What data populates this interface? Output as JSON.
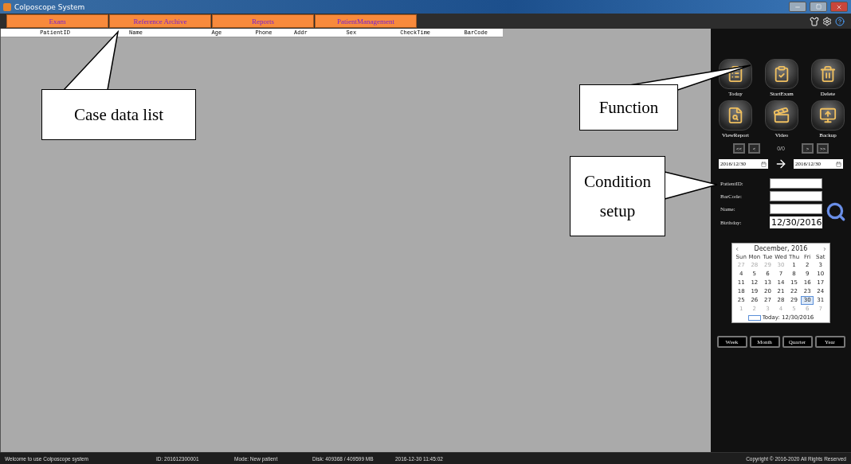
{
  "window": {
    "title": "Colposcope System"
  },
  "tabs": [
    {
      "label": "Exam",
      "selected": false
    },
    {
      "label": "Reference Archive",
      "selected": false
    },
    {
      "label": "Reports",
      "selected": false
    },
    {
      "label": "PatientManagement",
      "selected": false
    }
  ],
  "table": {
    "columns": [
      "PatientID",
      "Name",
      "Age",
      "Phone",
      "Addr",
      "Sex",
      "CheckTime",
      "BarCode"
    ]
  },
  "functions": [
    {
      "label": "Today",
      "kind": "today"
    },
    {
      "label": "StartExam",
      "kind": "start"
    },
    {
      "label": "Delete",
      "kind": "delete"
    },
    {
      "label": "ViewReport",
      "kind": "report"
    },
    {
      "label": "Video",
      "kind": "video"
    },
    {
      "label": "Backup",
      "kind": "backup"
    }
  ],
  "pager": {
    "first": "<<",
    "prev": "<",
    "count": "0/0",
    "next": ">",
    "last": ">>"
  },
  "date_range": {
    "from": "2016/12/30",
    "to": "2016/12/30"
  },
  "conditions": [
    {
      "label": "PatientID:",
      "kind": "text"
    },
    {
      "label": "BarCode:",
      "kind": "text"
    },
    {
      "label": "Name:",
      "kind": "text"
    },
    {
      "label": "Birthday:",
      "kind": "date",
      "value": "12/30/2016"
    }
  ],
  "calendar": {
    "title": "December, 2016",
    "weekdays": [
      "Sun",
      "Mon",
      "Tue",
      "Wed",
      "Thu",
      "Fri",
      "Sat"
    ],
    "weeks": [
      [
        {
          "day": "27",
          "other_month": true,
          "selected": false
        },
        {
          "day": "28",
          "other_month": true,
          "selected": false
        },
        {
          "day": "29",
          "other_month": true,
          "selected": false
        },
        {
          "day": "30",
          "other_month": true,
          "selected": false
        },
        {
          "day": "1",
          "other_month": false,
          "selected": false
        },
        {
          "day": "2",
          "other_month": false,
          "selected": false
        },
        {
          "day": "3",
          "other_month": false,
          "selected": false
        }
      ],
      [
        {
          "day": "4",
          "other_month": false,
          "selected": false
        },
        {
          "day": "5",
          "other_month": false,
          "selected": false
        },
        {
          "day": "6",
          "other_month": false,
          "selected": false
        },
        {
          "day": "7",
          "other_month": false,
          "selected": false
        },
        {
          "day": "8",
          "other_month": false,
          "selected": false
        },
        {
          "day": "9",
          "other_month": false,
          "selected": false
        },
        {
          "day": "10",
          "other_month": false,
          "selected": false
        }
      ],
      [
        {
          "day": "11",
          "other_month": false,
          "selected": false
        },
        {
          "day": "12",
          "other_month": false,
          "selected": false
        },
        {
          "day": "13",
          "other_month": false,
          "selected": false
        },
        {
          "day": "14",
          "other_month": false,
          "selected": false
        },
        {
          "day": "15",
          "other_month": false,
          "selected": false
        },
        {
          "day": "16",
          "other_month": false,
          "selected": false
        },
        {
          "day": "17",
          "other_month": false,
          "selected": false
        }
      ],
      [
        {
          "day": "18",
          "other_month": false,
          "selected": false
        },
        {
          "day": "19",
          "other_month": false,
          "selected": false
        },
        {
          "day": "20",
          "other_month": false,
          "selected": false
        },
        {
          "day": "21",
          "other_month": false,
          "selected": false
        },
        {
          "day": "22",
          "other_month": false,
          "selected": false
        },
        {
          "day": "23",
          "other_month": false,
          "selected": false
        },
        {
          "day": "24",
          "other_month": false,
          "selected": false
        }
      ],
      [
        {
          "day": "25",
          "other_month": false,
          "selected": false
        },
        {
          "day": "26",
          "other_month": false,
          "selected": false
        },
        {
          "day": "27",
          "other_month": false,
          "selected": false
        },
        {
          "day": "28",
          "other_month": false,
          "selected": false
        },
        {
          "day": "29",
          "other_month": false,
          "selected": false
        },
        {
          "day": "30",
          "other_month": false,
          "selected": true
        },
        {
          "day": "31",
          "other_month": false,
          "selected": false
        }
      ],
      [
        {
          "day": "1",
          "other_month": true,
          "selected": false
        },
        {
          "day": "2",
          "other_month": true,
          "selected": false
        },
        {
          "day": "3",
          "other_month": true,
          "selected": false
        },
        {
          "day": "4",
          "other_month": true,
          "selected": false
        },
        {
          "day": "5",
          "other_month": true,
          "selected": false
        },
        {
          "day": "6",
          "other_month": true,
          "selected": false
        },
        {
          "day": "7",
          "other_month": true,
          "selected": false
        }
      ]
    ],
    "today": "Today: 12/30/2016"
  },
  "periods": [
    "Week",
    "Month",
    "Quarter",
    "Year"
  ],
  "status_bar": {
    "welcome": "Welcome to use  Colposcope system",
    "id": "ID: 201612300001",
    "mode": "Mode:  New patient",
    "disk": "Disk:   409368 / 409599 MB",
    "time": "2016-12-30  11:45:02",
    "copyright": "Copyright © 2016-2020 All Rights Reserved"
  },
  "callouts": [
    {
      "text": "Case data list",
      "kind": "list"
    },
    {
      "text": "Function",
      "kind": "function"
    },
    {
      "text": "Condition setup",
      "kind": "condition"
    }
  ]
}
